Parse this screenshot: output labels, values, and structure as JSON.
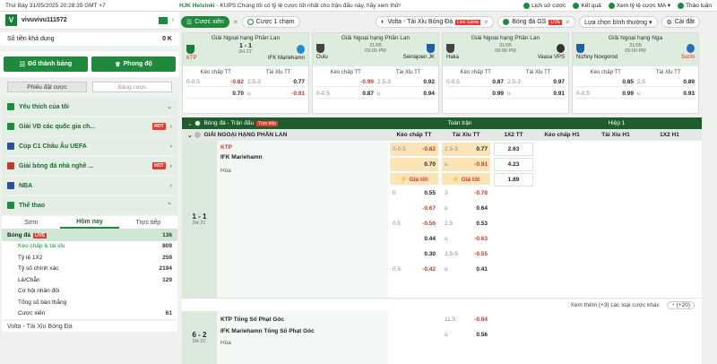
{
  "topbar": {
    "date": "Thứ Bảy 31/05/2025 20:28:35 GMT +7",
    "ticker_team": "HJK Helsinki",
    "ticker_text": "- KUPS:Chúng tôi có tỷ lệ cược tốt nhất cho trận đấu này, hãy xem thử!",
    "links": [
      "Lịch sử cược",
      "Kết quả",
      "Xem tỷ lệ cược MA ▾",
      "Thảo luận"
    ]
  },
  "account": {
    "logo": "V",
    "username": "vivuvivu111572",
    "balance_label": "Số tiền khả dụng",
    "balance": "0 K"
  },
  "buttons": {
    "best_odds": "Đổ thành bảng",
    "phong_do": "Phong độ"
  },
  "slip": {
    "tab1": "Phiếu đặt cược",
    "tab2": "Bảng cược"
  },
  "menu": [
    {
      "label": "Yêu thích của tôi",
      "badge": ""
    },
    {
      "label": "Giải VĐ các quốc gia ch...",
      "badge": "HOT"
    },
    {
      "label": "Cúp C1 Châu Âu UEFA",
      "badge": ""
    },
    {
      "label": "Giải bóng đá nhà nghề ...",
      "badge": "HOT"
    },
    {
      "label": "NBA",
      "badge": ""
    },
    {
      "label": "Thể thao",
      "badge": ""
    }
  ],
  "time_tabs": [
    "Sớm",
    "Hôm nay",
    "Trực tiếp"
  ],
  "sports": {
    "header": "Bóng đá",
    "header_badge": "LIVE",
    "header_count": "136",
    "rows": [
      {
        "label": "Kèo chấp & tài xỉu",
        "count": "809"
      },
      {
        "label": "Tỷ lệ 1X2",
        "count": "259"
      },
      {
        "label": "Tỷ số chính xác",
        "count": "2194"
      },
      {
        "label": "Lẻ/Chẵn",
        "count": "129"
      },
      {
        "label": "Cơ hội nhân đôi",
        "count": ""
      },
      {
        "label": "Tổng số bàn thắng",
        "count": ""
      },
      {
        "label": "Cược xiên",
        "count": "61"
      }
    ]
  },
  "left_last": "Volta - Tài Xỉu Bóng Đá",
  "tabs": {
    "bet_tab": "Cược xiên",
    "x": "✕",
    "single": "Cược 1 chạm",
    "live_tab": "Volta - Tài Xỉu Bóng Đá",
    "live_badge": "Live Game",
    "gs": "Bóng đá GS",
    "gs_badge": "LIVE",
    "sort": "Lựa chọn bình thường ▾",
    "settings": "Cài đặt"
  },
  "cards": [
    {
      "league": "Giải Ngoại hạng Phần Lan",
      "home": "KTP",
      "away": "IFK Mariehamn",
      "score": "1 - 1",
      "minute": "2H 21'",
      "date": "",
      "time": "",
      "odds_hdr": [
        "Kèo chấp TT",
        "Tài Xỉu TT"
      ],
      "r1": [
        "0-0.5",
        "-0.82",
        "2.5-3",
        "0.77"
      ],
      "r2": [
        "",
        "0.70",
        "u",
        "-0.91"
      ]
    },
    {
      "league": "Giải Ngoại hạng Phần Lan",
      "home": "Oulu",
      "away": "Seinajoen JK",
      "score": "",
      "minute": "",
      "date": "31/05",
      "time": "09:00 PM",
      "odds_hdr": [
        "Kèo chấp TT",
        "Tài Xỉu TT"
      ],
      "r1": [
        "",
        "-0.99",
        "2.5-3",
        "0.92"
      ],
      "r2": [
        "0-0.5",
        "0.87",
        "u",
        "0.94"
      ]
    },
    {
      "league": "Giải Ngoại hạng Phần Lan",
      "home": "Haka",
      "away": "Vaasa VPS",
      "score": "",
      "minute": "",
      "date": "31/05",
      "time": "09:00 PM",
      "odds_hdr": [
        "Kèo chấp TT",
        "Tài Xỉu TT"
      ],
      "r1": [
        "0-0.5",
        "0.87",
        "2.5-3",
        "0.97"
      ],
      "r2": [
        "",
        "0.99",
        "u",
        "0.91"
      ]
    },
    {
      "league": "Giải Ngoại hạng Nga",
      "home": "Nizhny Novgorod",
      "away": "Sochi",
      "score": "",
      "minute": "",
      "date": "31/05",
      "time": "09:00 PM",
      "odds_hdr": [
        "Kèo chấp TT",
        "Tài Xỉu TT"
      ],
      "r1": [
        "",
        "0.85",
        "2.5",
        "0.89"
      ],
      "r2": [
        "0-0.5",
        "0.99",
        "u",
        "0.93"
      ]
    }
  ],
  "table": {
    "title": "Bóng đá - Trận đấu",
    "badge": "Trực tiếp",
    "mid": "Toàn trận",
    "half": "Hiệp 1"
  },
  "cols": {
    "league": "GIẢI NGOẠI HẠNG PHẦN LAN",
    "c1": "Kèo chấp TT",
    "c2": "Tài Xỉu TT",
    "c3": "1X2 TT",
    "c4": "Kèo chấp H1",
    "c5": "Tài Xỉu H1",
    "c6": "1X2 H1"
  },
  "match1": {
    "score": "1 - 1",
    "minute": "2H 21'",
    "league": "KTP",
    "team2": "IFK Mariehamn",
    "draw": "Hòa",
    "best": "⚡ Giá tốt",
    "hc": [
      [
        "0-0.5",
        "-0.82"
      ],
      [
        "",
        "0.70"
      ],
      [
        "0",
        "0.55"
      ],
      [
        "",
        "-0.67"
      ],
      [
        "0.5",
        "-0.56"
      ],
      [
        "",
        "0.44"
      ],
      [
        "",
        "0.30"
      ],
      [
        "0.5",
        "-0.42"
      ]
    ],
    "ou": [
      [
        "2.5-3",
        "0.77"
      ],
      [
        "u",
        "-0.91"
      ],
      [
        "3",
        "-0.78"
      ],
      [
        "u",
        "0.64"
      ],
      [
        "2.5",
        "0.53"
      ],
      [
        "u",
        "-0.63"
      ],
      [
        "3.5-5",
        "-0.55"
      ],
      [
        "u",
        "0.41"
      ]
    ],
    "x12": [
      "2.63",
      "4.23",
      "1.89"
    ]
  },
  "more": {
    "text": "Xem thêm (+3) các loại cược khác",
    "count": "(+20)"
  },
  "match2": {
    "score": "6 - 2",
    "minute": "2H 21'",
    "team1": "KTP Tổng Số Phạt Góc",
    "team2": "IFK Mariehamn Tổng Số Phạt Góc",
    "draw": "Hòa",
    "ou": [
      [
        "11.5",
        "-0.84"
      ],
      [
        "u",
        "0.56"
      ]
    ]
  },
  "colors": {
    "green": "#1f8a3c",
    "dark": "#1f5c2e",
    "red": "#d3342a",
    "highlight": "#fbe4b8"
  }
}
